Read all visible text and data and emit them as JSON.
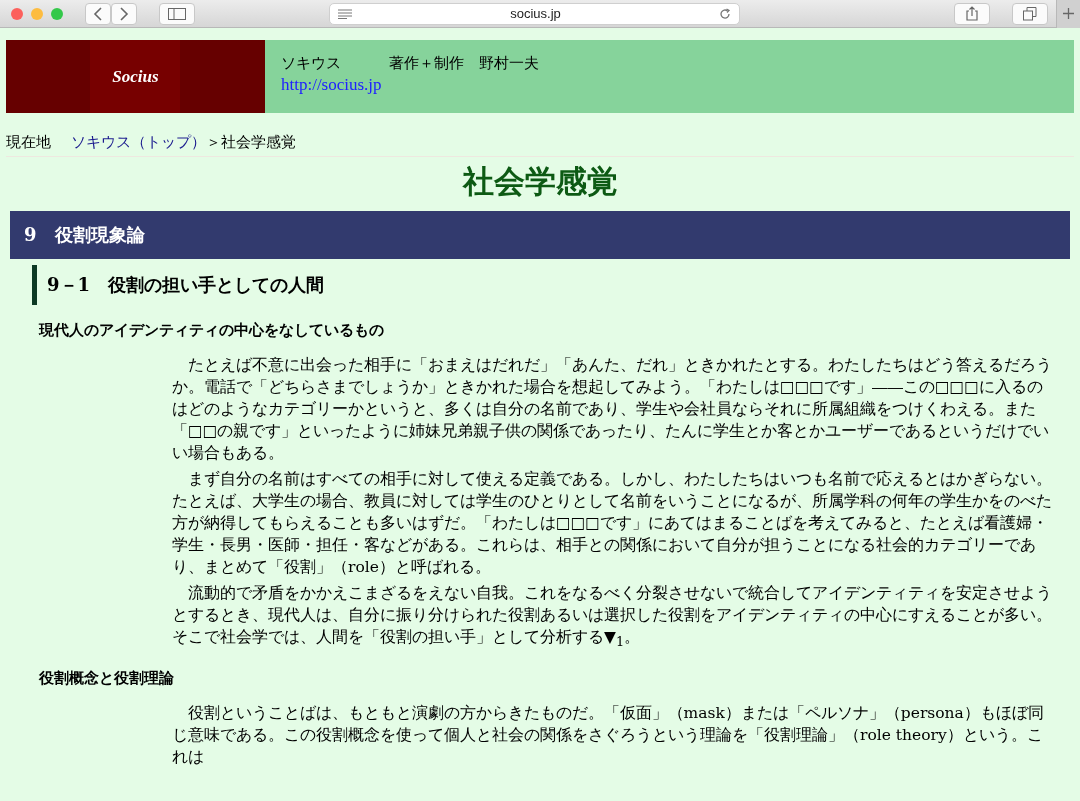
{
  "browser": {
    "address": "socius.jp"
  },
  "header": {
    "logo": "Socius",
    "site_name": "ソキウス",
    "credit": "著作＋制作　野村一夫",
    "url": "http://socius.jp"
  },
  "breadcrumb": {
    "label": "現在地",
    "link": "ソキウス（トップ）",
    "current": "＞社会学感覚"
  },
  "title": "社会学感覚",
  "chapter": "9　役割現象論",
  "section": "9－1　役割の担い手としての人間",
  "subsections": [
    {
      "heading": "現代人のアイデンティティの中心をなしているもの",
      "paragraphs": [
        "たとえば不意に出会った相手に「おまえはだれだ」「あんた、だれ」ときかれたとする。わたしたちはどう答えるだろうか。電話で「どちらさまでしょうか」ときかれた場合を想起してみよう。「わたしは□□□です」――この□□□に入るのはどのようなカテゴリーかというと、多くは自分の名前であり、学生や会社員ならそれに所属組織をつけくわえる。また「□□の親です」といったように姉妹兄弟親子供の関係であったり、たんに学生とか客とかユーザーであるというだけでいい場合もある。",
        "まず自分の名前はすべての相手に対して使える定義である。しかし、わたしたちはいつも名前で応えるとはかぎらない。たとえば、大学生の場合、教員に対しては学生のひとりとして名前をいうことになるが、所属学科の何年の学生かをのべた方が納得してもらえることも多いはずだ。「わたしは□□□です」にあてはまることばを考えてみると、たとえば看護婦・学生・長男・医師・担任・客などがある。これらは、相手との関係において自分が担うことになる社会的カテゴリーであり、まとめて「役割」（role）と呼ばれる。",
        "流動的で矛盾をかかえこまざるをえない自我。これをなるべく分裂させないで統合してアイデンティティを安定させようとするとき、現代人は、自分に振り分けられた役割あるいは選択した役割をアイデンティティの中心にすえることが多い。そこで社会学では、人間を「役割の担い手」として分析する▼$_{1}$。"
      ]
    },
    {
      "heading": "役割概念と役割理論",
      "paragraphs": [
        "役割ということばは、もともと演劇の方からきたものだ。「仮面」（mask）または「ペルソナ」（persona）もほぼ同じ意味である。この役割概念を使って個人と社会の関係をさぐろうという理論を「役割理論」（role theory）という。これは"
      ]
    }
  ]
}
